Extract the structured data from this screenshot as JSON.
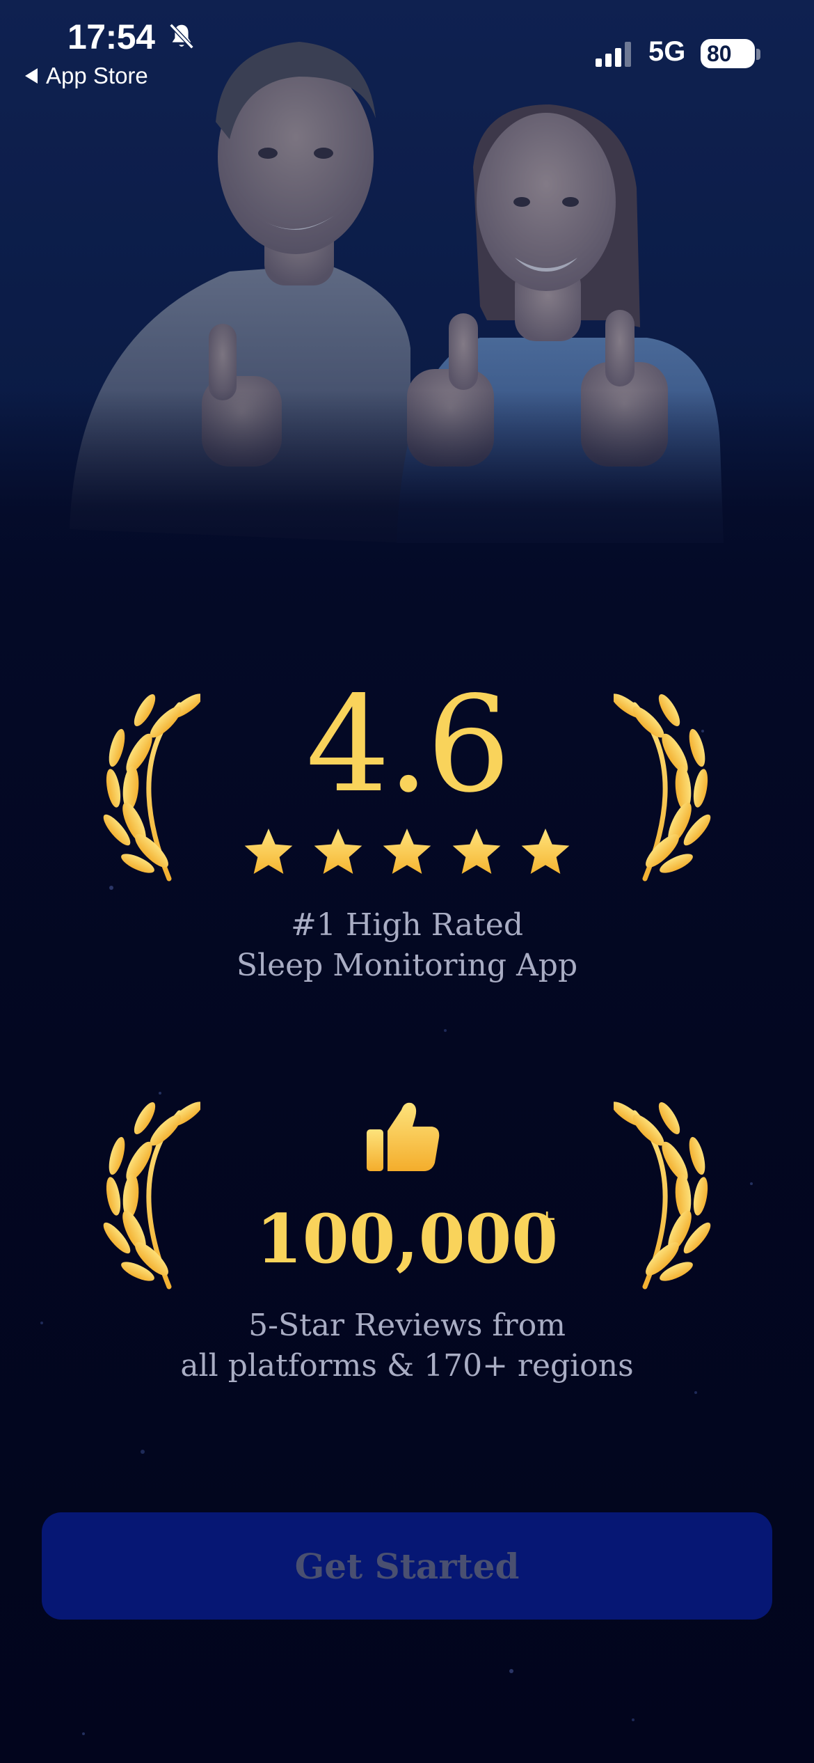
{
  "status_bar": {
    "time": "17:54",
    "back_label": "App Store",
    "network": "5G",
    "battery": "80",
    "icons": [
      "bell-slash-icon",
      "signal-icon",
      "battery-icon"
    ]
  },
  "rating": {
    "value": "4.6",
    "stars": 5,
    "caption_line1": "#1 High Rated",
    "caption_line2": "Sleep Monitoring App"
  },
  "reviews": {
    "count": "100,000",
    "suffix": "+",
    "caption_line1": "5-Star Reviews from",
    "caption_line2": "all platforms & 170+ regions",
    "icon": "thumbs-up-icon"
  },
  "cta": {
    "label": "Get Started"
  },
  "colors": {
    "gold": "#f9d35b",
    "background": "#030722",
    "button": "#061774",
    "caption": "#a9adc4"
  }
}
